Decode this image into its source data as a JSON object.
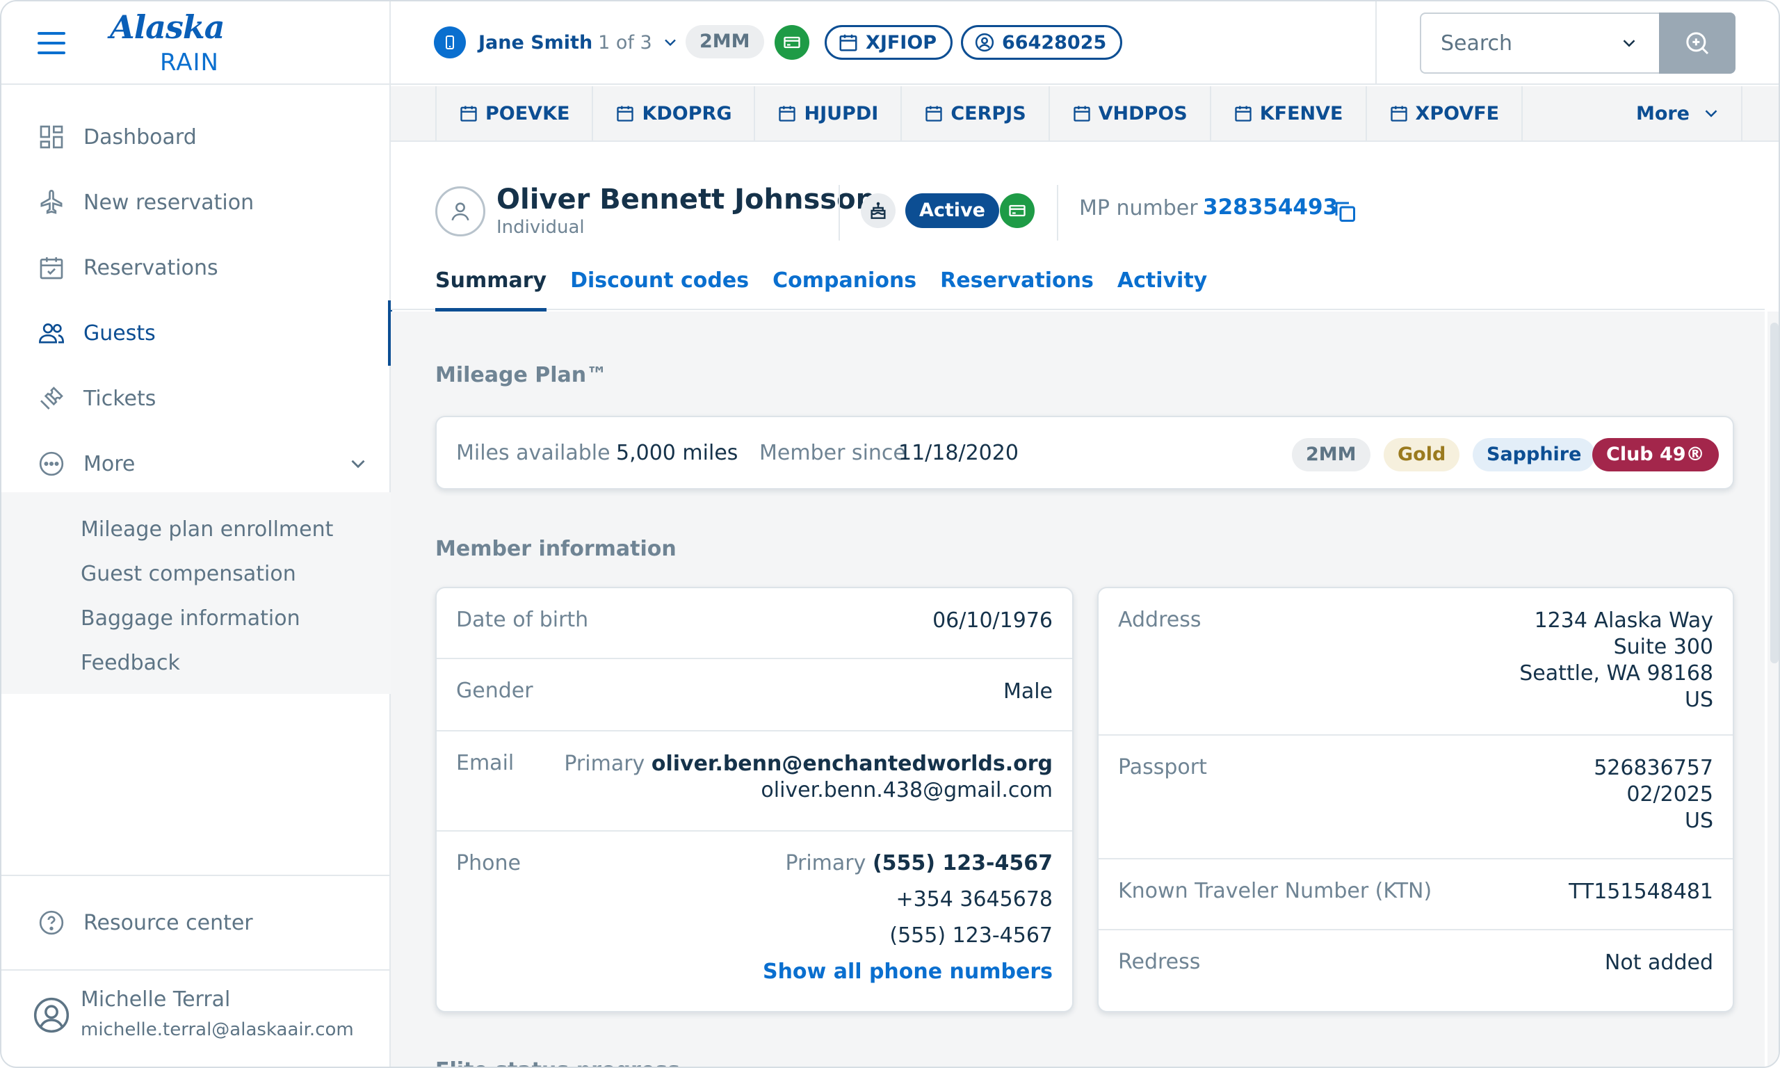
{
  "brand": {
    "logo": "Alaska",
    "product": "RAIN"
  },
  "sidebar": {
    "items": [
      {
        "label": "Dashboard",
        "icon": "dashboard-icon"
      },
      {
        "label": "New reservation",
        "icon": "plane-icon"
      },
      {
        "label": "Reservations",
        "icon": "calendar-icon"
      },
      {
        "label": "Guests",
        "icon": "guests-icon"
      },
      {
        "label": "Tickets",
        "icon": "ticket-icon"
      },
      {
        "label": "More",
        "icon": "more-icon"
      }
    ],
    "sub_items": [
      "Mileage plan enrollment",
      "Guest compensation",
      "Baggage information",
      "Feedback"
    ],
    "resource_center": "Resource center",
    "user": {
      "name": "Michelle Terral",
      "email": "michelle.terral@alaskaair.com"
    }
  },
  "topbar": {
    "agent_name": "Jane Smith",
    "agent_count": "1 of 3",
    "tier": "2MM",
    "pnr": "XJFIOP",
    "mp_id": "66428025",
    "search": {
      "placeholder": "Search"
    }
  },
  "pnr_tabs": [
    "POEVKE",
    "KDOPRG",
    "HJUPDI",
    "CERPJS",
    "VHDPOS",
    "KFENVE",
    "XPOVFE"
  ],
  "pnr_more": "More",
  "guest": {
    "name": "Oliver Bennett Johnsson",
    "type": "Individual",
    "status": "Active",
    "mp_label": "MP number",
    "mp_number": "328354493",
    "tabs": [
      "Summary",
      "Discount codes",
      "Companions",
      "Reservations",
      "Activity"
    ]
  },
  "mileage": {
    "title": "Mileage Plan™",
    "miles_label": "Miles available",
    "miles_value": "5,000 miles",
    "since_label": "Member since",
    "since_value": "11/18/2020",
    "badges": [
      "2MM",
      "Gold",
      "Sapphire",
      "Club 49®"
    ],
    "badge_colors": {
      "2MM": "#eceef0",
      "Gold": "#f6f0dd",
      "Sapphire": "#e3eef8",
      "Club 49®": "#a3264b"
    }
  },
  "member": {
    "title": "Member information",
    "dob_label": "Date of birth",
    "dob": "06/10/1976",
    "gender_label": "Gender",
    "gender": "Male",
    "email_label": "Email",
    "primary_label": "Primary",
    "email_primary": "oliver.benn@enchantedworlds.org",
    "email_alt": "oliver.benn.438@gmail.com",
    "phone_label": "Phone",
    "phone_primary": "(555) 123-4567",
    "phone_2": "+354 3645678",
    "phone_3": "(555) 123-4567",
    "show_phones": "Show all phone numbers",
    "address_label": "Address",
    "address": [
      "1234 Alaska Way",
      "Suite 300",
      "Seattle, WA 98168",
      "US"
    ],
    "passport_label": "Passport",
    "passport": [
      "526836757",
      "02/2025",
      "US"
    ],
    "ktn_label": "Known Traveler Number (KTN)",
    "ktn": "TT151548481",
    "redress_label": "Redress",
    "redress": "Not added"
  },
  "next_section": "Elite status progress"
}
